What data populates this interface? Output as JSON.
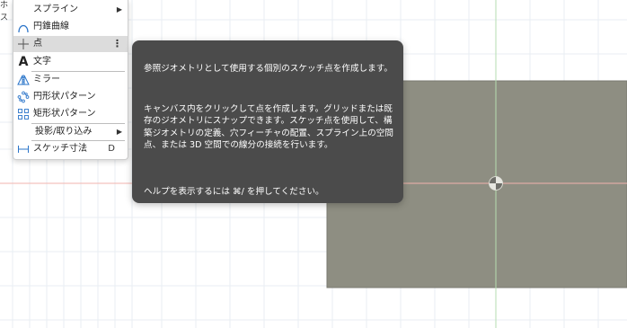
{
  "menu": {
    "items": [
      {
        "label": "スプライン",
        "icon": "spline-icon",
        "submenu": true
      },
      {
        "label": "円錐曲線",
        "icon": "conic-curve-icon"
      },
      {
        "label": "点",
        "icon": "point-icon",
        "more": "⋮",
        "highlighted": true
      },
      {
        "label": "文字",
        "icon": "text-icon"
      },
      {
        "label": "ミラー",
        "icon": "mirror-icon"
      },
      {
        "label": "円形状パターン",
        "icon": "circular-pattern-icon"
      },
      {
        "label": "矩形状パターン",
        "icon": "rectangular-pattern-icon"
      },
      {
        "label": "投影/取り込み",
        "submenu": true
      },
      {
        "label": "スケッチ寸法",
        "icon": "sketch-dimension-icon",
        "shortcut": "D"
      }
    ]
  },
  "left_cutoff": {
    "line1": "ホ",
    "line2": "ス"
  },
  "tooltip": {
    "title": "参照ジオメトリとして使用する個別のスケッチ点を作成します。",
    "body": "キャンバス内をクリックして点を作成します。グリッドまたは既存のジオメトリにスナップできます。スケッチ点を使用して、構築ジオメトリの定義、穴フィーチャの配置、スプライン上の空間点、または 3D 空間での線分の接続を行います。",
    "help": "ヘルプを表示するには ⌘/ を押してください。"
  },
  "colors": {
    "grid": "#e9eef3",
    "axis_red": "#f2b3ad",
    "axis_green": "#b5ddb0",
    "profile_fill": "#8e8e82",
    "accent_icon": "#2a74c9",
    "tooltip_bg": "#4b4b4b"
  }
}
